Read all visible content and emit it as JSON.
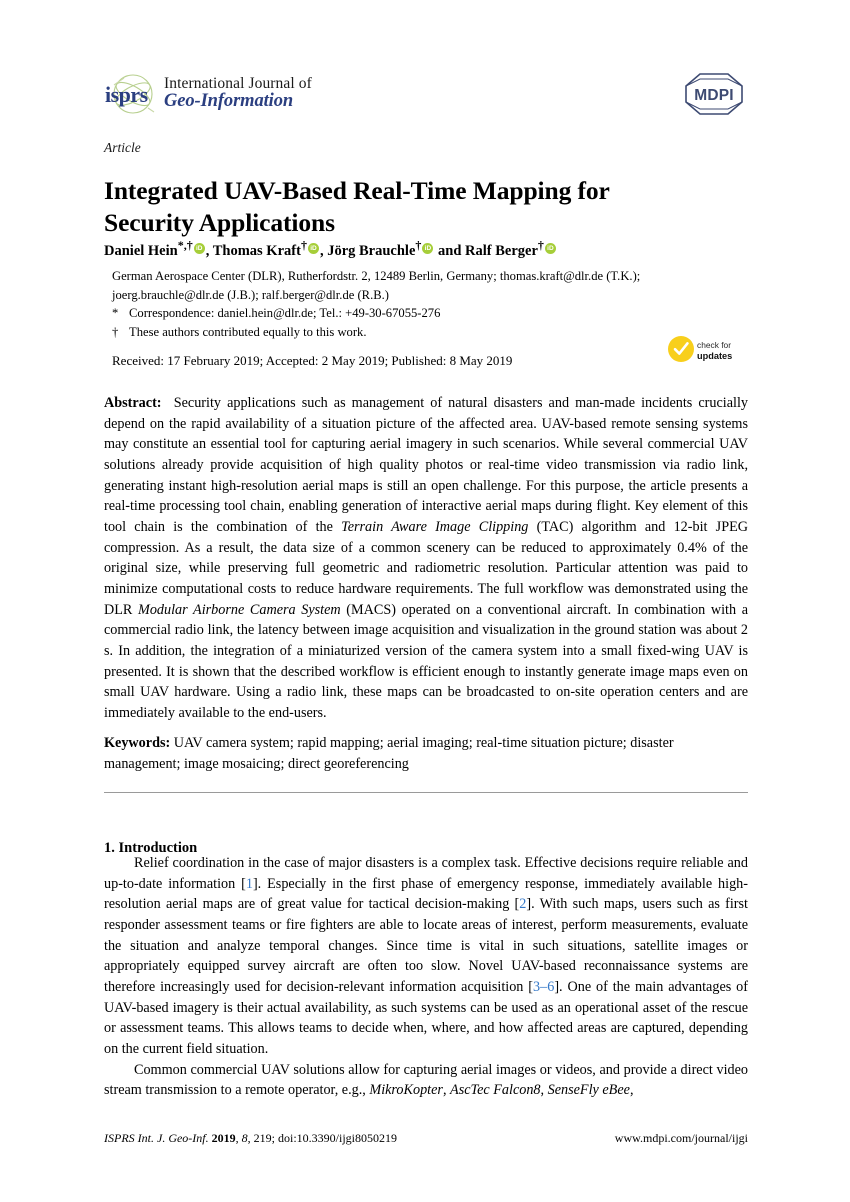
{
  "journal": {
    "logo_mark": "isprs-globe-logo",
    "logo_wordmark": "isprs",
    "line1": "International Journal of",
    "line2": "Geo-Information",
    "publisher_logo": "mdpi-logo",
    "publisher_name": "MDPI",
    "brand_blue": "#2b3f80",
    "brand_green": "#8fb04a"
  },
  "article": {
    "type_label": "Article",
    "title": "Integrated UAV-Based Real-Time Mapping for Security Applications",
    "authors_html": "Daniel Hein *,† ⟨orcid⟩, Thomas Kraft † ⟨orcid⟩, Jörg Brauchle † ⟨orcid⟩ and Ralf Berger † ⟨orcid⟩",
    "authors": [
      {
        "name": "Daniel Hein",
        "marks": "*,†",
        "orcid": true
      },
      {
        "name": "Thomas Kraft",
        "marks": "†",
        "orcid": true
      },
      {
        "name": "Jörg Brauchle",
        "marks": "†",
        "orcid": true
      },
      {
        "name": "Ralf Berger",
        "marks": "†",
        "orcid": true
      }
    ],
    "author_conjunction": "and",
    "affiliation_line1": "German Aerospace Center (DLR), Rutherfordstr. 2, 12489 Berlin, Germany; thomas.kraft@dlr.de (T.K.);",
    "affiliation_line2": "joerg.brauchle@dlr.de (J.B.); ralf.berger@dlr.de (R.B.)",
    "correspondence_marker": "*",
    "correspondence": "Correspondence: daniel.hein@dlr.de; Tel.: +49-30-67055-276",
    "equal_marker": "†",
    "equal_contribution": "These authors contributed equally to this work.",
    "dates": "Received: 17 February 2019; Accepted: 2 May 2019; Published: 8 May 2019"
  },
  "crossmark": {
    "icon": "check-circle-icon",
    "line1": "check for",
    "line2": "updates",
    "color": "#f8cf1c"
  },
  "abstract": {
    "label": "Abstract:",
    "parts": [
      {
        "text": "Security applications such as management of natural disasters and man-made incidents crucially depend on the rapid availability of a situation picture of the affected area. UAV-based remote sensing systems may constitute an essential tool for capturing aerial imagery in such scenarios. While several commercial UAV solutions already provide acquisition of high quality photos or real-time video transmission via radio link, generating instant high-resolution aerial maps is still an open challenge. For this purpose, the article presents a real-time processing tool chain, enabling generation of interactive aerial maps during flight. Key element of this tool chain is the combination of the ",
        "italic": false
      },
      {
        "text": "Terrain Aware Image Clipping",
        "italic": true
      },
      {
        "text": " (TAC) algorithm and 12-bit JPEG compression. As a result, the data size of a common scenery can be reduced to approximately 0.4% of the original size, while preserving full geometric and radiometric resolution. Particular attention was paid to minimize computational costs to reduce hardware requirements. The full workflow was demonstrated using the DLR ",
        "italic": false
      },
      {
        "text": "Modular Airborne Camera System",
        "italic": true
      },
      {
        "text": " (MACS) operated on a conventional aircraft. In combination with a commercial radio link, the latency between image acquisition and visualization in the ground station was about 2 s. In addition, the integration of a miniaturized version of the camera system into a small fixed-wing UAV is presented. It is shown that the described workflow is efficient enough to instantly generate image maps even on small UAV hardware. Using a radio link, these maps can be broadcasted to on-site operation centers and are immediately available to the end-users.",
        "italic": false
      }
    ]
  },
  "keywords": {
    "label": "Keywords:",
    "text": "UAV camera system; rapid mapping; aerial imaging; real-time situation picture; disaster management; image mosaicing; direct georeferencing"
  },
  "body": {
    "section_number_title": "1. Introduction",
    "paragraph1": [
      {
        "text": "Relief coordination in the case of major disasters is a complex task. Effective decisions require reliable and up-to-date information [",
        "kind": "plain"
      },
      {
        "text": "1",
        "kind": "cite"
      },
      {
        "text": "]. Especially in the first phase of emergency response, immediately available high-resolution aerial maps are of great value for tactical decision-making [",
        "kind": "plain"
      },
      {
        "text": "2",
        "kind": "cite"
      },
      {
        "text": "]. With such maps, users such as first responder assessment teams or fire fighters are able to locate areas of interest, perform measurements, evaluate the situation and analyze temporal changes. Since time is vital in such situations, satellite images or appropriately equipped survey aircraft are often too slow. Novel UAV-based reconnaissance systems are therefore increasingly used for decision-relevant information acquisition [",
        "kind": "plain"
      },
      {
        "text": "3–6",
        "kind": "cite"
      },
      {
        "text": "]. One of the main advantages of UAV-based imagery is their actual availability, as such systems can be used as an operational asset of the rescue or assessment teams. This allows teams to decide when, where, and how affected areas are captured, depending on the current field situation.",
        "kind": "plain"
      }
    ],
    "paragraph2": [
      {
        "text": "Common commercial UAV solutions allow for capturing aerial images or videos, and provide a direct video stream transmission to a remote operator, e.g., ",
        "kind": "plain"
      },
      {
        "text": "MikroKopter",
        "kind": "italic"
      },
      {
        "text": ", ",
        "kind": "plain"
      },
      {
        "text": "AscTec Falcon8",
        "kind": "italic"
      },
      {
        "text": ", ",
        "kind": "plain"
      },
      {
        "text": "SenseFly eBee",
        "kind": "italic"
      },
      {
        "text": ",",
        "kind": "plain"
      }
    ]
  },
  "footer": {
    "citation_journal": "ISPRS Int. J. Geo-Inf.",
    "citation_year": "2019",
    "citation_volume": "8",
    "citation_article": "219",
    "citation_doi": "doi:10.3390/ijgi8050219",
    "url": "www.mdpi.com/journal/ijgi"
  }
}
